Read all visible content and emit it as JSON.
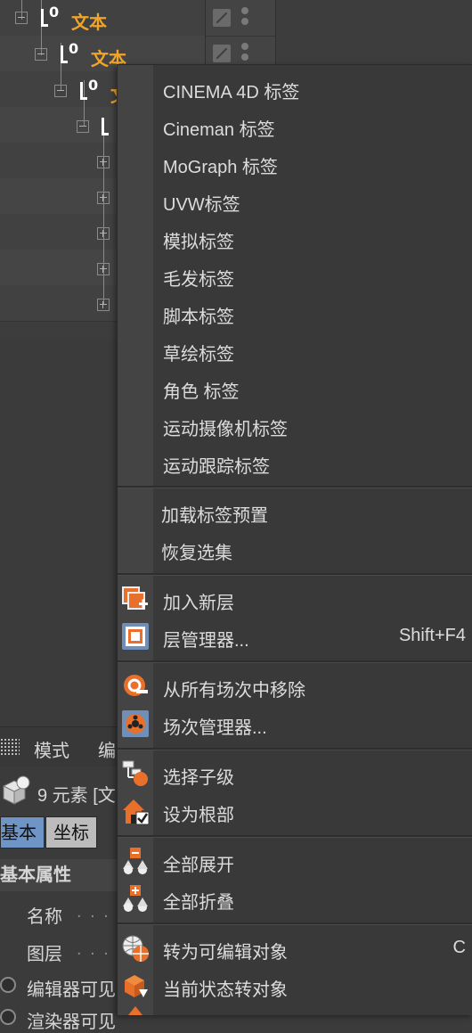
{
  "tree": {
    "rows": [
      {
        "label": "文本"
      },
      {
        "label": "文本"
      },
      {
        "label": "文"
      }
    ]
  },
  "menu": {
    "items": [
      {
        "label": "CINEMA 4D 标签"
      },
      {
        "label": "Cineman 标签"
      },
      {
        "label": "MoGraph 标签"
      },
      {
        "label": "UVW标签"
      },
      {
        "label": "模拟标签"
      },
      {
        "label": "毛发标签"
      },
      {
        "label": "脚本标签"
      },
      {
        "label": "草绘标签"
      },
      {
        "label": "角色 标签"
      },
      {
        "label": "运动摄像机标签"
      },
      {
        "label": "运动跟踪标签"
      },
      {
        "label": "加载标签预置"
      },
      {
        "label": "恢复选集"
      },
      {
        "label": "加入新层",
        "icon": "add-layer-icon"
      },
      {
        "label": "层管理器...",
        "shortcut": "Shift+F4",
        "icon": "layer-manager-icon"
      },
      {
        "label": "从所有场次中移除",
        "icon": "remove-take-icon"
      },
      {
        "label": "场次管理器...",
        "icon": "take-manager-icon"
      },
      {
        "label": "选择子级",
        "icon": "select-children-icon"
      },
      {
        "label": "设为根部",
        "icon": "set-as-root-icon"
      },
      {
        "label": "全部展开",
        "icon": "expand-all-icon"
      },
      {
        "label": "全部折叠",
        "icon": "collapse-all-icon"
      },
      {
        "label": "转为可编辑对象",
        "shortcut": "C",
        "icon": "make-editable-icon"
      },
      {
        "label": "当前状态转对象",
        "icon": "current-state-to-object-icon"
      }
    ]
  },
  "attr": {
    "menu_mode": "模式",
    "menu_edit": "编",
    "element_count": "9 元素 [文",
    "tab_basic": "基本",
    "tab_coord": "坐标",
    "section_title": "基本属性",
    "prop_name": "名称",
    "prop_layer": "图层",
    "prop_editor_visible": "编辑器可见",
    "prop_render_visible": "渲染器可见",
    "dots": ". . . ."
  },
  "colors": {
    "accent_orange": "#f0a52a",
    "tab_active": "#6f95c7",
    "icon_orange": "#e8702a"
  }
}
